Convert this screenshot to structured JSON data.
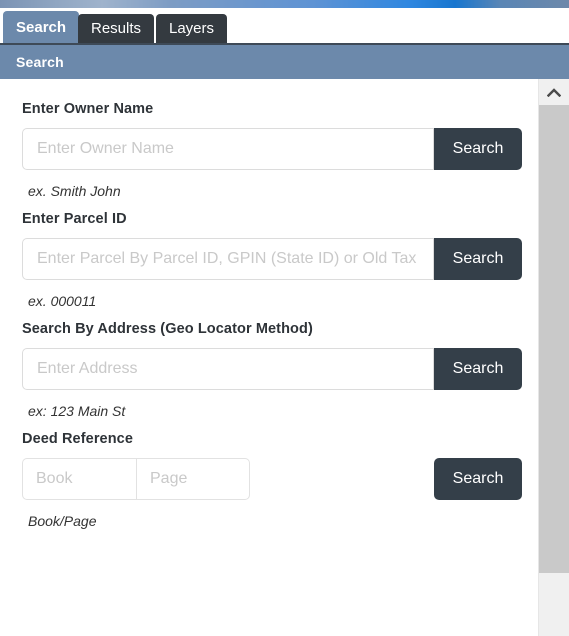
{
  "tabs": [
    {
      "id": "search",
      "label": "Search",
      "active": true
    },
    {
      "id": "results",
      "label": "Results",
      "active": false
    },
    {
      "id": "layers",
      "label": "Layers",
      "active": false
    }
  ],
  "panel": {
    "header_title": "Search"
  },
  "search_form": {
    "owner": {
      "label": "Enter Owner Name",
      "placeholder": "Enter Owner Name",
      "value": "",
      "button_label": "Search",
      "hint": "ex. Smith John"
    },
    "parcel": {
      "label": "Enter Parcel ID",
      "placeholder": "Enter Parcel By Parcel ID, GPIN (State ID) or Old Tax ID",
      "value": "",
      "button_label": "Search",
      "hint": "ex. 000011"
    },
    "address": {
      "label": "Search By Address (Geo Locator Method)",
      "placeholder": "Enter Address",
      "value": "",
      "button_label": "Search",
      "hint": "ex: 123 Main St"
    },
    "deed": {
      "label": "Deed Reference",
      "book_placeholder": "Book",
      "book_value": "",
      "page_placeholder": "Page",
      "page_value": "",
      "button_label": "Search",
      "hint": "Book/Page"
    }
  },
  "scrollbar": {
    "up_arrow_icon": "chevron-up-icon"
  },
  "colors": {
    "tab_active_bg": "#6c89ab",
    "tab_inactive_bg": "#343a40",
    "panel_header_bg": "#6c89ab",
    "button_bg": "#343f49",
    "placeholder_text": "#c9c9c9",
    "label_text": "#2e3338",
    "scrollbar_thumb": "#c9c9c9",
    "top_strip_accent": "#1876cf"
  }
}
